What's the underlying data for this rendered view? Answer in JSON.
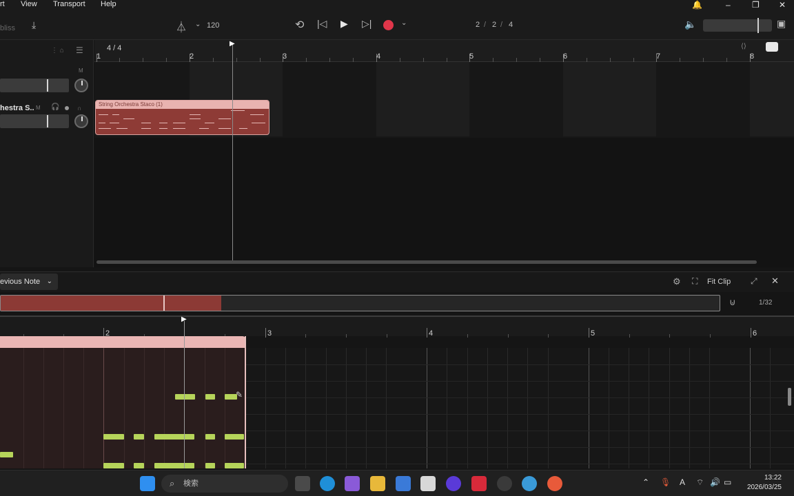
{
  "menu": {
    "items": [
      "rt",
      "View",
      "Transport",
      "Help"
    ]
  },
  "toolbar": {
    "tempo": "120",
    "position": {
      "bar": "2",
      "beat": "2",
      "tick": "4"
    },
    "left_cut_text": "bliss"
  },
  "arrange": {
    "time_signature": "4 / 4",
    "ruler_bars": [
      "1",
      "2",
      "3",
      "4",
      "5",
      "6",
      "7",
      "8"
    ],
    "track_label_cut": "hestra S..",
    "track_letters": [
      "M",
      "M"
    ],
    "clip_title": "String Orchestra Staco (1)"
  },
  "editor": {
    "dropdown_label": "evious Note",
    "fit_clip_label": "Fit Clip",
    "grid_value": "1/32",
    "ruler_bars": [
      "2",
      "3",
      "4",
      "5",
      "6"
    ]
  },
  "taskbar": {
    "search_placeholder": "検索",
    "time": "13:22",
    "date": "2026/03/25",
    "ime": "A"
  },
  "colors": {
    "clip": "#8e3b36",
    "clip_header": "#e9b3b0",
    "note": "#b6d45a",
    "record": "#e0364a"
  }
}
